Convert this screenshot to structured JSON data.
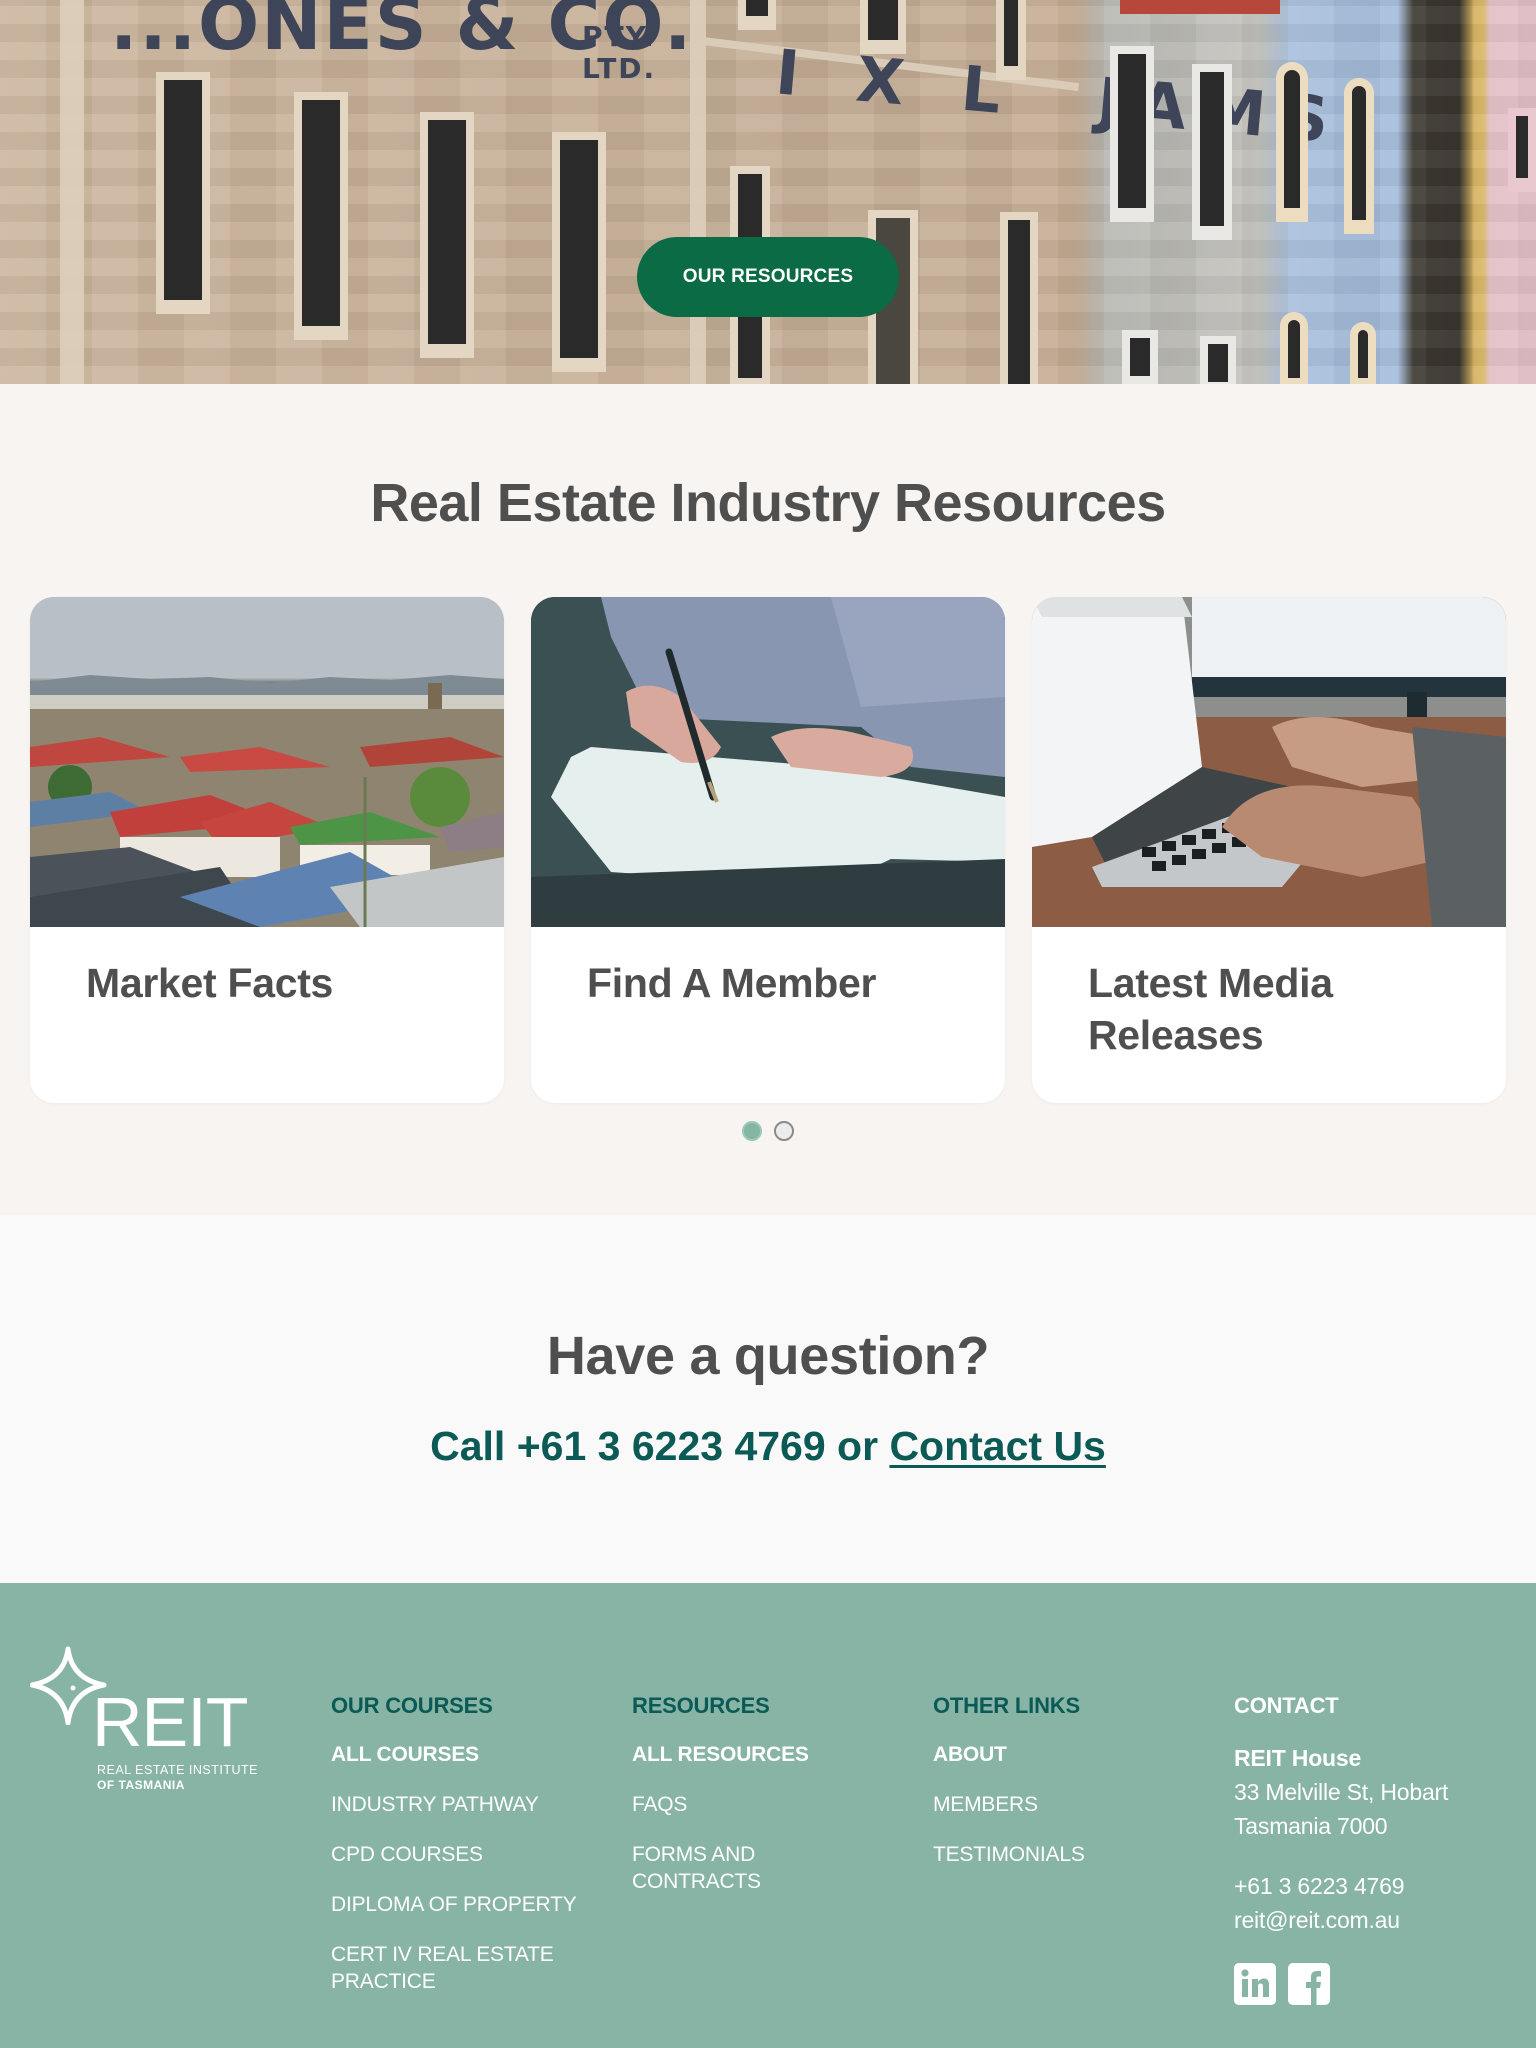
{
  "hero": {
    "signs": [
      "...ONES & CO.",
      "PTY.",
      "LTD.",
      "I X L  JAMS."
    ],
    "button_label": "OUR RESOURCES"
  },
  "resources": {
    "title": "Real Estate Industry Resources",
    "cards": [
      {
        "title": "Market Facts",
        "image": "hobart-rooftops-photo"
      },
      {
        "title": "Find A Member",
        "image": "signing-document-photo"
      },
      {
        "title": "Latest Media Releases",
        "image": "laptop-typing-photo"
      }
    ],
    "carousel": {
      "pages": 2,
      "active_page": 1
    }
  },
  "question": {
    "title": "Have a question?",
    "call_prefix": "Call +61 3 6223 4769 or ",
    "contact_link": "Contact Us"
  },
  "footer": {
    "logo": {
      "wordmark": "REIT",
      "sub1": "REAL ESTATE INSTITUTE",
      "sub2": "OF TASMANIA"
    },
    "columns": [
      {
        "heading": "OUR COURSES",
        "links": [
          "ALL COURSES",
          "INDUSTRY PATHWAY",
          "CPD COURSES",
          "DIPLOMA OF PROPERTY",
          "CERT IV REAL ESTATE PRACTICE"
        ]
      },
      {
        "heading": "RESOURCES",
        "links": [
          "ALL RESOURCES",
          "FAQS",
          "FORMS AND CONTRACTS"
        ]
      },
      {
        "heading": "OTHER LINKS",
        "links": [
          "ABOUT",
          "MEMBERS",
          "TESTIMONIALS"
        ]
      }
    ],
    "contact": {
      "heading": "CONTACT",
      "name": "REIT House",
      "address_line1": "33 Melville St, Hobart",
      "address_line2": "Tasmania 7000",
      "phone": "+61 3 6223 4769",
      "email": "reit@reit.com.au",
      "social": [
        {
          "name": "linkedin-icon",
          "glyph": "in"
        },
        {
          "name": "facebook-icon",
          "glyph": "f"
        }
      ]
    }
  },
  "colors": {
    "primary_green": "#0b6b45",
    "teal_text": "#0b5a55",
    "footer_bg": "#87b4a4",
    "resources_bg": "#f8f4f1",
    "heading_grey": "#4f4f4f"
  }
}
